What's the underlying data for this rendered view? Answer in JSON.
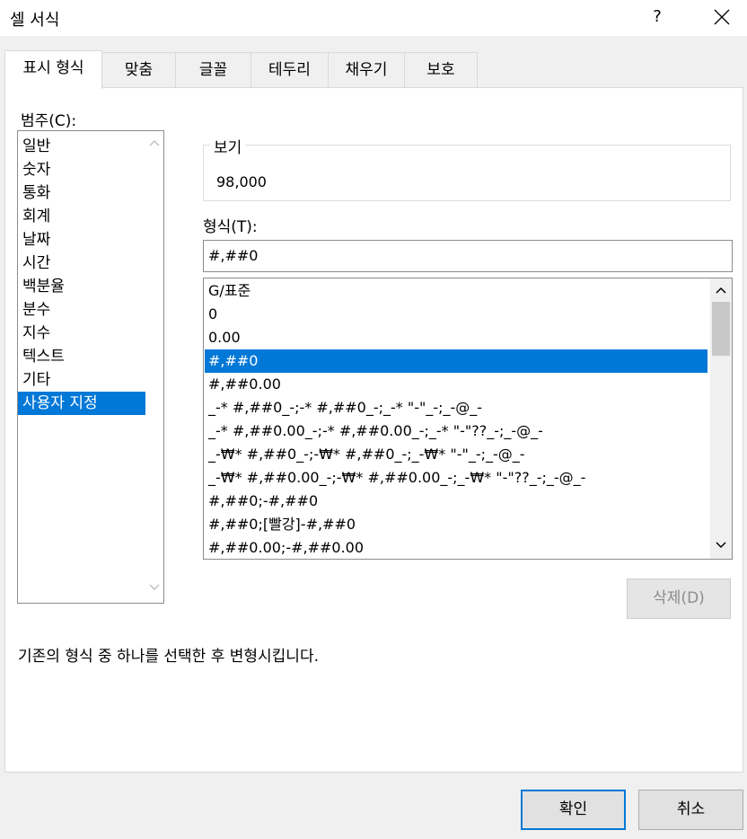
{
  "window": {
    "title": "셀 서식",
    "help": "?"
  },
  "tabs": [
    {
      "label": "표시 형식"
    },
    {
      "label": "맞춤"
    },
    {
      "label": "글꼴"
    },
    {
      "label": "테두리"
    },
    {
      "label": "채우기"
    },
    {
      "label": "보호"
    }
  ],
  "category": {
    "label": "범주(C):",
    "items": [
      "일반",
      "숫자",
      "통화",
      "회계",
      "날짜",
      "시간",
      "백분율",
      "분수",
      "지수",
      "텍스트",
      "기타",
      "사용자 지정"
    ],
    "selected": "사용자 지정"
  },
  "preview": {
    "legend": "보기",
    "value": "98,000"
  },
  "format": {
    "label": "형식(T):",
    "input_value": "#,##0",
    "items": [
      "G/표준",
      "0",
      "0.00",
      "#,##0",
      "#,##0.00",
      "_-* #,##0_-;-* #,##0_-;_-* \"-\"_-;_-@_-",
      "_-* #,##0.00_-;-* #,##0.00_-;_-* \"-\"??_-;_-@_-",
      "_-₩* #,##0_-;-₩* #,##0_-;_-₩* \"-\"_-;_-@_-",
      "_-₩* #,##0.00_-;-₩* #,##0.00_-;_-₩* \"-\"??_-;_-@_-",
      "#,##0;-#,##0",
      "#,##0;[빨강]-#,##0",
      "#,##0.00;-#,##0.00"
    ],
    "selected": "#,##0"
  },
  "delete_button": "삭제(D)",
  "description": "기존의 형식 중 하나를 선택한 후 변형시킵니다.",
  "footer": {
    "ok": "확인",
    "cancel": "취소"
  },
  "colors": {
    "accent": "#0078d7"
  }
}
